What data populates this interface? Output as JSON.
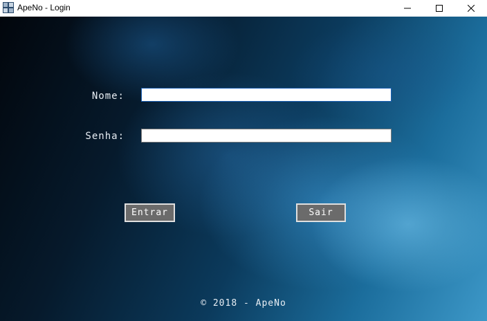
{
  "window": {
    "title": "ApeNo - Login",
    "controls": {
      "minimize_icon": "minimize-icon",
      "maximize_icon": "maximize-icon",
      "close_icon": "close-icon"
    }
  },
  "form": {
    "nome_label": "Nome:",
    "nome_value": "",
    "senha_label": "Senha:",
    "senha_value": ""
  },
  "buttons": {
    "entrar_label": "Entrar",
    "sair_label": "Sair"
  },
  "footer": {
    "text": "© 2018 - ApeNo"
  },
  "colors": {
    "button_bg": "#6b6b6b",
    "button_border": "#e0e0e0",
    "label_text": "#e8eef4",
    "focus_border": "#1a5fb4"
  }
}
